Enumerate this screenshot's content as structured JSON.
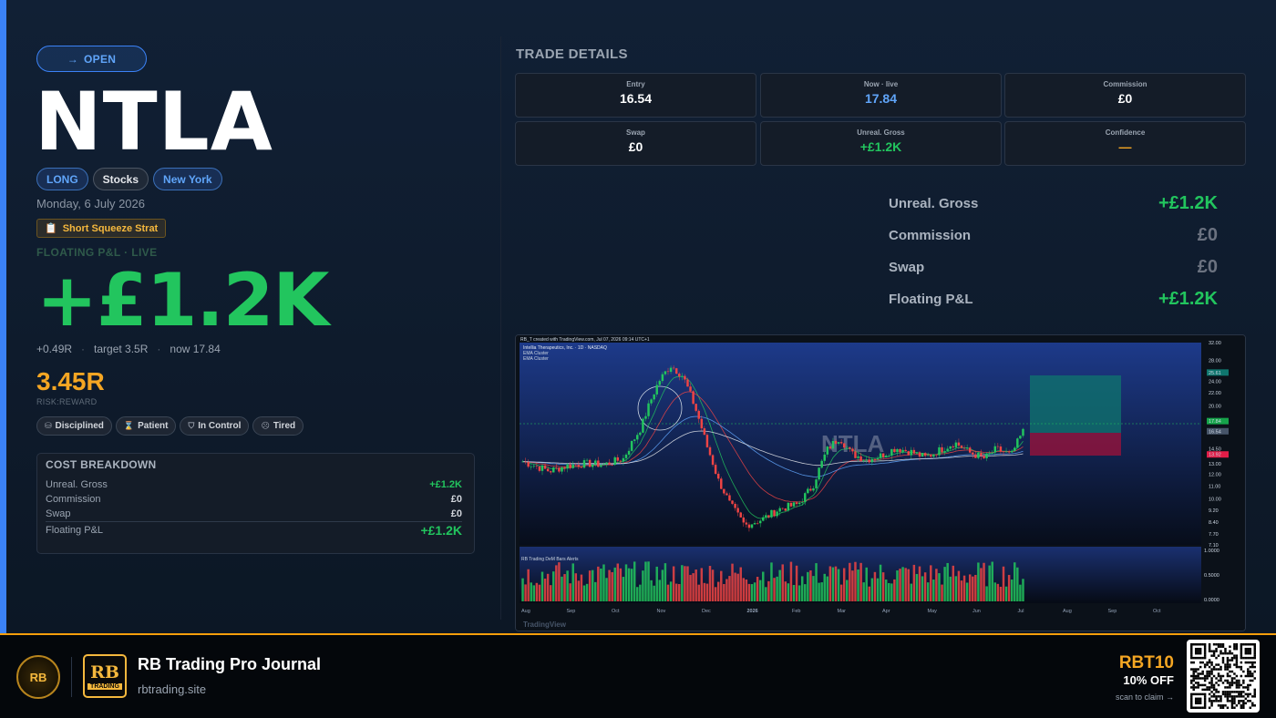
{
  "header": {
    "status": "OPEN",
    "status_arrow": "→",
    "ticker": "NTLA",
    "tags": [
      "LONG",
      "Stocks",
      "New York"
    ],
    "date": "Monday, 6 July 2026",
    "strategy": "Short Squeeze Strat",
    "strategy_icon": "clipboard-icon"
  },
  "pnl": {
    "label": "FLOATING P&L · LIVE",
    "value": "+£1.2K",
    "r_multiple": "+0.49R",
    "target": "target 3.5R",
    "now": "now 17.84",
    "risk_reward": "3.45R",
    "risk_reward_label": "RISK:REWARD"
  },
  "emotions": [
    {
      "label": "Disciplined",
      "icon": "database-icon"
    },
    {
      "label": "Patient",
      "icon": "hourglass-icon"
    },
    {
      "label": "In Control",
      "icon": "shield-icon"
    },
    {
      "label": "Tired",
      "icon": "tired-face-icon"
    }
  ],
  "cost_breakdown": {
    "title": "COST BREAKDOWN",
    "rows": [
      {
        "label": "Unreal. Gross",
        "value": "+£1.2K"
      },
      {
        "label": "Commission",
        "value": "£0"
      },
      {
        "label": "Swap",
        "value": "£0"
      },
      {
        "label": "Floating P&L",
        "value": "+£1.2K"
      }
    ]
  },
  "trade_details": {
    "title": "TRADE DETAILS",
    "tiles": [
      {
        "label": "Entry",
        "value": "16.54"
      },
      {
        "label": "Now · live",
        "value": "17.84"
      },
      {
        "label": "Commission",
        "value": "£0"
      },
      {
        "label": "Swap",
        "value": "£0"
      },
      {
        "label": "Unreal. Gross",
        "value": "+£1.2K"
      },
      {
        "label": "Confidence",
        "value": "—"
      }
    ]
  },
  "summary": [
    {
      "label": "Unreal. Gross",
      "value": "+£1.2K"
    },
    {
      "label": "Commission",
      "value": "£0"
    },
    {
      "label": "Swap",
      "value": "£0"
    },
    {
      "label": "Floating P&L",
      "value": "+£1.2K"
    }
  ],
  "chart": {
    "header": "RB_T created with TradingView.com, Jul 07, 2026 09:14 UTC+1",
    "symbol_line": "Intellia Therapeutics, Inc. · 1D · NASDAQ",
    "indicator_1": "EMA Cluster",
    "indicator_2": "EMA Cluster",
    "watermark": "NTLA",
    "sub_title": "RB Trading DeM Bars Alerts",
    "footer": "TradingView",
    "price_axis": [
      "32.00",
      "28.00",
      "25.61",
      "24.00",
      "22.00",
      "20.00",
      "17.84",
      "16.54",
      "14.50",
      "13.92",
      "13.00",
      "12.00",
      "11.00",
      "10.00",
      "9.20",
      "8.40",
      "7.70",
      "7.10"
    ],
    "sub_axis": [
      "1.0000",
      "0.5000",
      "0.0000"
    ],
    "months": [
      "Aug",
      "Sep",
      "Oct",
      "Nov",
      "Dec",
      "2026",
      "Feb",
      "Mar",
      "Apr",
      "May",
      "Jun",
      "Jul",
      "Aug",
      "Sep",
      "Oct"
    ],
    "now_price": "17.84",
    "entry_price": "16.54",
    "target_price": "25.61",
    "stop_price": "13.92",
    "colors": {
      "up": "#22c55e",
      "down": "#ef4444",
      "target_zone": "#0f766e",
      "stop_zone": "#9f1239"
    }
  },
  "footer": {
    "badge": "RB",
    "logo_text": "RB",
    "logo_sub": "TRADING",
    "brand": "RB Trading Pro Journal",
    "url": "rbtrading.site",
    "promo_code": "RBT10",
    "promo_off": "10% OFF",
    "promo_scan": "scan to claim →"
  },
  "colors": {
    "accent": "#3b82f6",
    "profit": "#22c55e",
    "gold": "#f5a623"
  }
}
